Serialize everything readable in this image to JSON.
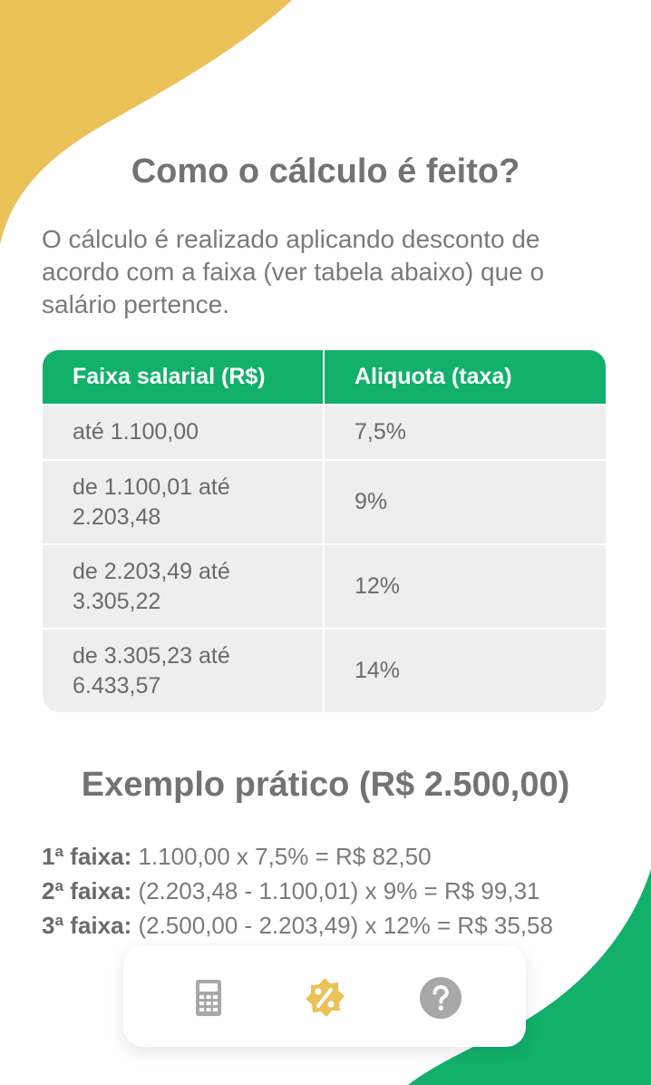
{
  "colors": {
    "accent_yellow": "#ebc257",
    "accent_green": "#12b06a",
    "text_gray": "#737373",
    "table_row_bg": "#eeeeee"
  },
  "section": {
    "title": "Como o cálculo é feito?",
    "description": "O cálculo é realizado aplicando desconto de acordo com a faixa (ver tabela abaixo) que o salário pertence."
  },
  "table": {
    "headers": [
      "Faixa salarial (R$)",
      "Aliquota (taxa)"
    ],
    "rows": [
      {
        "range": "até 1.100,00",
        "rate": "7,5%"
      },
      {
        "range": "de 1.100,01 até 2.203,48",
        "rate": "9%"
      },
      {
        "range": "de 2.203,49 até 3.305,22",
        "rate": "12%"
      },
      {
        "range": "de 3.305,23 até 6.433,57",
        "rate": "14%"
      }
    ]
  },
  "example": {
    "title": "Exemplo prático (R$ 2.500,00)",
    "lines": [
      {
        "label": "1ª faixa:",
        "text": "1.100,00 x 7,5% = R$ 82,50"
      },
      {
        "label": "2ª faixa:",
        "text": "(2.203,48 - 1.100,01) x 9% = R$ 99,31"
      },
      {
        "label": "3ª faixa:",
        "text": "(2.500,00 - 2.203,49) x 12% = R$ 35,58"
      }
    ]
  },
  "bottom_nav": {
    "items": [
      {
        "icon": "calculator-icon",
        "active": false
      },
      {
        "icon": "percent-badge-icon",
        "active": true
      },
      {
        "icon": "help-circle-icon",
        "active": false
      }
    ]
  }
}
